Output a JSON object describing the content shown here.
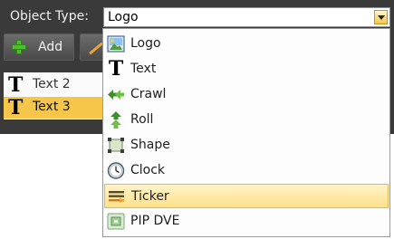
{
  "toolbar": {
    "object_type_label": "Object Type:",
    "add_label": "Add"
  },
  "combo": {
    "selected_value": "Logo"
  },
  "object_list": [
    {
      "label": "Text 2",
      "icon": "text-t-icon",
      "selected": false
    },
    {
      "label": "Text 3",
      "icon": "text-t-icon",
      "selected": true
    }
  ],
  "dropdown": {
    "options": [
      {
        "label": "Logo",
        "icon": "logo-image-icon"
      },
      {
        "label": "Text",
        "icon": "text-t-icon"
      },
      {
        "label": "Crawl",
        "icon": "crawl-arrows-icon"
      },
      {
        "label": "Roll",
        "icon": "roll-arrows-icon"
      },
      {
        "label": "Shape",
        "icon": "shape-icon"
      },
      {
        "label": "Clock",
        "icon": "clock-icon"
      },
      {
        "label": "Ticker",
        "icon": "ticker-icon",
        "highlighted": true
      },
      {
        "label": "PIP DVE",
        "icon": "pip-dve-icon"
      }
    ]
  },
  "colors": {
    "panel_background": "#3a3a3a",
    "selection": "#f5c64a",
    "hover_highlight": "#fde08a",
    "add_icon_green": "#49c22a"
  }
}
